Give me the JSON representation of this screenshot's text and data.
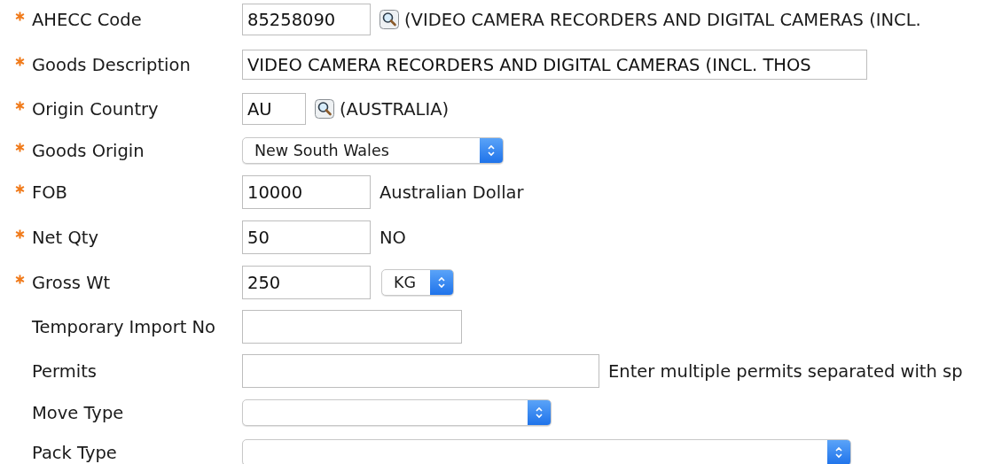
{
  "fields": [
    {
      "label": "AHECC Code",
      "required": true,
      "controls": [
        {
          "kind": "text",
          "value": "85258090"
        },
        {
          "kind": "lookup"
        },
        {
          "kind": "note",
          "text": "(VIDEO CAMERA RECORDERS AND DIGITAL CAMERAS (INCL."
        }
      ]
    },
    {
      "label": "Goods Description",
      "required": true,
      "controls": [
        {
          "kind": "text",
          "value": "VIDEO CAMERA RECORDERS AND DIGITAL CAMERAS (INCL. THOS"
        }
      ]
    },
    {
      "label": "Origin Country",
      "required": true,
      "controls": [
        {
          "kind": "text",
          "value": "AU"
        },
        {
          "kind": "lookup"
        },
        {
          "kind": "note",
          "text": "(AUSTRALIA)"
        }
      ]
    },
    {
      "label": "Goods Origin",
      "required": true,
      "controls": [
        {
          "kind": "select",
          "value": "New South Wales"
        }
      ]
    },
    {
      "label": "FOB",
      "required": true,
      "controls": [
        {
          "kind": "text",
          "value": "10000"
        },
        {
          "kind": "note",
          "text": "Australian Dollar"
        }
      ]
    },
    {
      "label": "Net Qty",
      "required": true,
      "controls": [
        {
          "kind": "text",
          "value": "50"
        },
        {
          "kind": "note",
          "text": "NO"
        }
      ]
    },
    {
      "label": "Gross Wt",
      "required": true,
      "controls": [
        {
          "kind": "text",
          "value": "250"
        },
        {
          "kind": "select",
          "value": "KG"
        }
      ]
    },
    {
      "label": "Temporary Import No",
      "required": false,
      "controls": [
        {
          "kind": "text"
        }
      ]
    },
    {
      "label": "Permits",
      "required": false,
      "controls": [
        {
          "kind": "text"
        },
        {
          "kind": "note",
          "text": "Enter multiple permits separated with sp"
        }
      ]
    },
    {
      "label": "Move Type",
      "required": false,
      "controls": [
        {
          "kind": "select"
        }
      ]
    },
    {
      "label": "Pack Type",
      "required": false,
      "controls": [
        {
          "kind": "select"
        }
      ]
    }
  ]
}
